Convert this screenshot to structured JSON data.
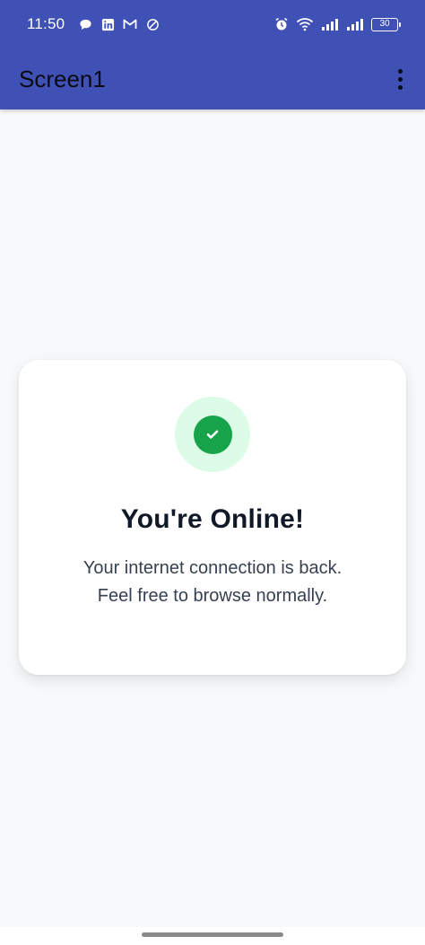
{
  "status_bar": {
    "time": "11:50",
    "battery_level": "30",
    "left_icons": [
      "chat-bubble-icon",
      "linkedin-icon",
      "gmail-icon",
      "do-not-disturb-icon"
    ],
    "right_icons": [
      "alarm-icon",
      "wifi-icon",
      "signal-icon",
      "signal-icon",
      "battery-icon"
    ]
  },
  "app_bar": {
    "title": "Screen1",
    "menu_icon": "more-vert-icon",
    "color": "#3f51b5"
  },
  "card": {
    "icon": "check-circle-icon",
    "icon_color": "#16a34a",
    "icon_halo_color": "#dcfce7",
    "title": "You're Online!",
    "message_line1": "Your internet connection is back.",
    "message_line2": "Feel free to browse normally."
  }
}
